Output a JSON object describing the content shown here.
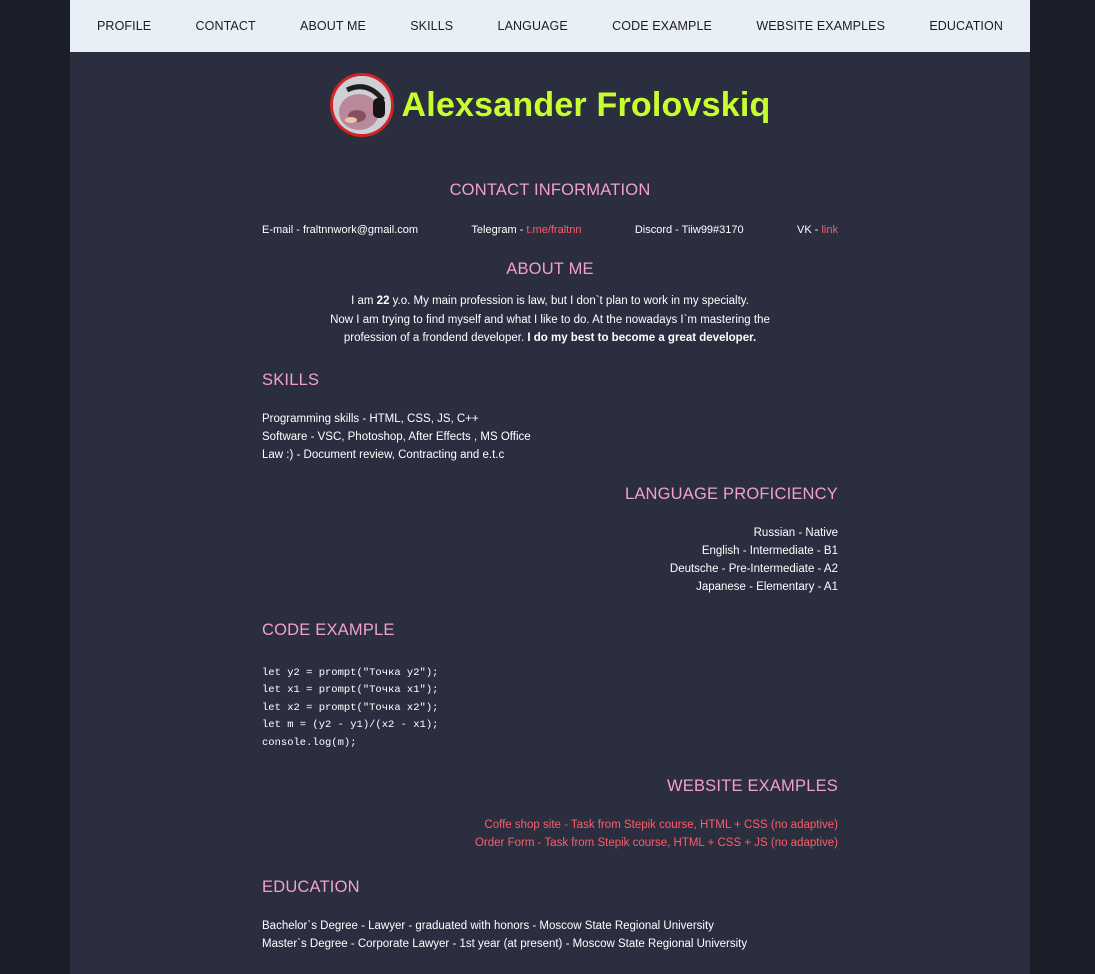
{
  "nav": {
    "items": [
      "PROFILE",
      "CONTACT",
      "ABOUT ME",
      "SKILLS",
      "LANGUAGE",
      "CODE EXAMPLE",
      "WEBSITE EXAMPLES",
      "EDUCATION"
    ]
  },
  "profile": {
    "name": "Alexsander Frolovskiq"
  },
  "contact": {
    "title": "CONTACT INFORMATION",
    "email_label": "E-mail - fraltnnwork@gmail.com",
    "telegram_label": "Telegram - ",
    "telegram_link": "t.me/fraltnn",
    "discord_label": "Discord - Tiiw99#3170",
    "vk_label": "VK - ",
    "vk_link": "link"
  },
  "about": {
    "title": "ABOUT ME",
    "t1": "I am ",
    "age": "22",
    "t2": " y.o. My main profession is law, but I don`t plan to work in my specialty.",
    "t3": "Now I am trying to find myself and what I like to do. At the nowadays I`m mastering the",
    "t4": "profession of a frondend developer. ",
    "t5": "I do my best to become a great developer."
  },
  "skills": {
    "title": "SKILLS",
    "items": [
      "Programming skills - HTML, CSS, JS, C++",
      "Software - VSC, Photoshop, After Effects , MS Office",
      "Law :) - Document review, Contracting and e.t.c"
    ]
  },
  "language": {
    "title": "LANGUAGE PROFICIENCY",
    "items": [
      "Russian - Native",
      "English - Intermediate - B1",
      "Deutsche - Pre-Intermediate - A2",
      "Japanese - Elementary - A1"
    ]
  },
  "code": {
    "title": "CODE EXAMPLE",
    "lines": [
      "let y2 = prompt(\"Точка y2\");",
      "let x1 = prompt(\"Точка x1\");",
      "let x2 = prompt(\"Точка x2\");",
      "let m = (y2 - y1)/(x2 - x1);",
      "console.log(m);"
    ]
  },
  "websites": {
    "title": "WEBSITE EXAMPLES",
    "items": [
      "Coffe shop site - Task from Stepik course, HTML + CSS (no adaptive)",
      "Order Form - Task from Stepik course, HTML + CSS + JS (no adaptive)"
    ]
  },
  "education": {
    "title": "EDUCATION",
    "items": [
      "Bachelor`s Degree - Lawyer - graduated with honors - Moscow State Regional University",
      "Master`s Degree - Corporate Lawyer - 1st year (at present) - Moscow State Regional University"
    ]
  },
  "colors": {
    "accent_name": "#c6ff2d",
    "heading": "#f3a0c8",
    "link": "#ff5b6a",
    "background": "#2b2e3f",
    "nav_bg": "#e8eff6"
  }
}
